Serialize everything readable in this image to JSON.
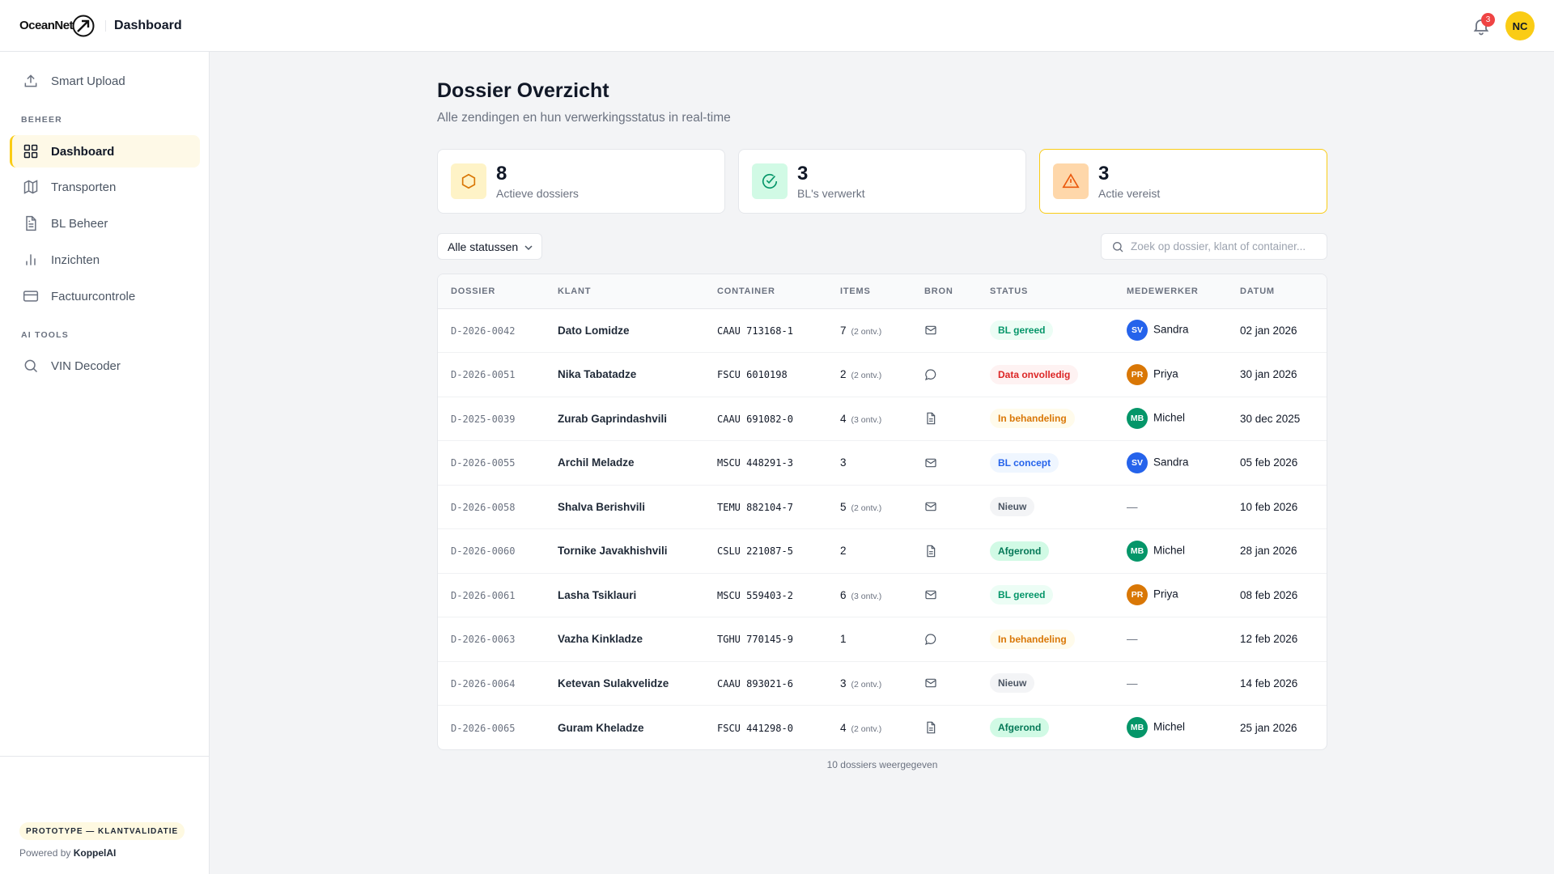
{
  "header": {
    "brand": "OceanNet",
    "title": "Dashboard",
    "notifications": "3",
    "user_initials": "NC"
  },
  "sidebar": {
    "smart_upload": "Smart Upload",
    "section_beheer": "BEHEER",
    "items": [
      "Dashboard",
      "Transporten",
      "BL Beheer",
      "Inzichten",
      "Factuurcontrole"
    ],
    "section_ai": "AI TOOLS",
    "vin": "VIN Decoder",
    "prototype": "PROTOTYPE — KLANTVALIDATIE",
    "powered_prefix": "Powered by",
    "powered_brand": "KoppelAI"
  },
  "page": {
    "title": "Dossier Overzicht",
    "subtitle": "Alle zendingen en hun verwerkingsstatus in real-time"
  },
  "stats": [
    {
      "value": "8",
      "label": "Actieve dossiers",
      "icon": "box-icon"
    },
    {
      "value": "3",
      "label": "BL's verwerkt",
      "icon": "check-circle-icon"
    },
    {
      "value": "3",
      "label": "Actie vereist",
      "icon": "warning-icon"
    }
  ],
  "filter": {
    "selected": "Alle statussen"
  },
  "search": {
    "placeholder": "Zoek op dossier, klant of container..."
  },
  "table": {
    "columns": [
      "DOSSIER",
      "KLANT",
      "CONTAINER",
      "ITEMS",
      "BRON",
      "STATUS",
      "MEDEWERKER",
      "DATUM"
    ],
    "rows": [
      {
        "dossier": "D-2026-0042",
        "klant": "Dato Lomidze",
        "container": "CAAU 713168-1",
        "items": "7",
        "received": "(2 ontv.)",
        "bron": "mail",
        "status": "BL gereed",
        "initials": "SV",
        "medewerker": "Sandra",
        "datum": "02 jan 2026"
      },
      {
        "dossier": "D-2026-0051",
        "klant": "Nika Tabatadze",
        "container": "FSCU 6010198",
        "items": "2",
        "received": "(2 ontv.)",
        "bron": "chat",
        "status": "Data onvolledig",
        "initials": "PR",
        "medewerker": "Priya",
        "datum": "30 jan 2026"
      },
      {
        "dossier": "D-2025-0039",
        "klant": "Zurab Gaprindashvili",
        "container": "CAAU 691082-0",
        "items": "4",
        "received": "(3 ontv.)",
        "bron": "doc",
        "status": "In behandeling",
        "initials": "MB",
        "medewerker": "Michel",
        "datum": "30 dec 2025"
      },
      {
        "dossier": "D-2026-0055",
        "klant": "Archil Meladze",
        "container": "MSCU 448291-3",
        "items": "3",
        "received": null,
        "bron": "mail",
        "status": "BL concept",
        "initials": "SV",
        "medewerker": "Sandra",
        "datum": "05 feb 2026"
      },
      {
        "dossier": "D-2026-0058",
        "klant": "Shalva Berishvili",
        "container": "TEMU 882104-7",
        "items": "5",
        "received": "(2 ontv.)",
        "bron": "mail",
        "status": "Nieuw",
        "initials": null,
        "medewerker": "—",
        "datum": "10 feb 2026"
      },
      {
        "dossier": "D-2026-0060",
        "klant": "Tornike Javakhishvili",
        "container": "CSLU 221087-5",
        "items": "2",
        "received": null,
        "bron": "doc",
        "status": "Afgerond",
        "initials": "MB",
        "medewerker": "Michel",
        "datum": "28 jan 2026"
      },
      {
        "dossier": "D-2026-0061",
        "klant": "Lasha Tsiklauri",
        "container": "MSCU 559403-2",
        "items": "6",
        "received": "(3 ontv.)",
        "bron": "mail",
        "status": "BL gereed",
        "initials": "PR",
        "medewerker": "Priya",
        "datum": "08 feb 2026"
      },
      {
        "dossier": "D-2026-0063",
        "klant": "Vazha Kinkladze",
        "container": "TGHU 770145-9",
        "items": "1",
        "received": null,
        "bron": "chat",
        "status": "In behandeling",
        "initials": null,
        "medewerker": "—",
        "datum": "12 feb 2026"
      },
      {
        "dossier": "D-2026-0064",
        "klant": "Ketevan Sulakvelidze",
        "container": "CAAU 893021-6",
        "items": "3",
        "received": "(2 ontv.)",
        "bron": "mail",
        "status": "Nieuw",
        "initials": null,
        "medewerker": "—",
        "datum": "14 feb 2026"
      },
      {
        "dossier": "D-2026-0065",
        "klant": "Guram Kheladze",
        "container": "FSCU 441298-0",
        "items": "4",
        "received": "(2 ontv.)",
        "bron": "doc",
        "status": "Afgerond",
        "initials": "MB",
        "medewerker": "Michel",
        "datum": "25 jan 2026"
      }
    ],
    "footer": "10 dossiers weergegeven"
  },
  "colors": {
    "accent": "#facc15",
    "status": {
      "BL gereed": [
        "#ecfdf5",
        "#059669"
      ],
      "Data onvolledig": [
        "#fef2f2",
        "#dc2626"
      ],
      "In behandeling": [
        "#fffbeb",
        "#d97706"
      ],
      "BL concept": [
        "#eff6ff",
        "#2563eb"
      ],
      "Nieuw": [
        "#f3f4f6",
        "#4b5563"
      ],
      "Afgerond": [
        "#d1fae5",
        "#047857"
      ]
    },
    "avatars": {
      "SV": "#2563eb",
      "PR": "#d97706",
      "MB": "#059669"
    }
  }
}
